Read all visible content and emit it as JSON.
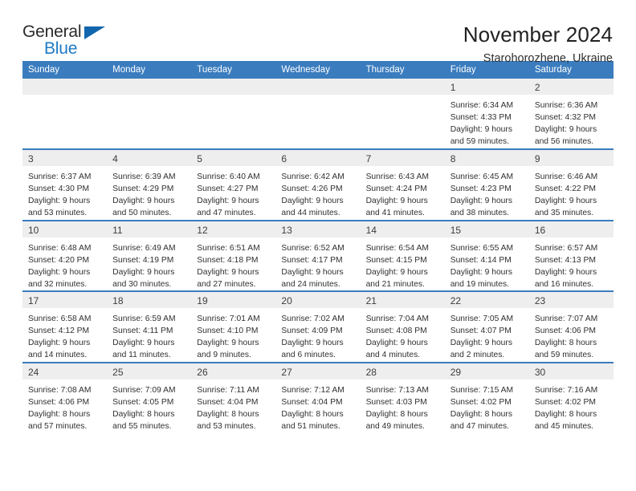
{
  "brand": {
    "name_part1": "General",
    "name_part2": "Blue",
    "mark": "triangle-logo"
  },
  "header": {
    "title": "November 2024",
    "location": "Starohorozhene, Ukraine"
  },
  "calendar": {
    "weekday_headers": [
      "Sunday",
      "Monday",
      "Tuesday",
      "Wednesday",
      "Thursday",
      "Friday",
      "Saturday"
    ],
    "accent_color": "#3a7cbe",
    "daynum_band_color": "#eeeeee",
    "weeks": [
      [
        {
          "day": "",
          "sunrise": "",
          "sunset": "",
          "daylight_line1": "",
          "daylight_line2": ""
        },
        {
          "day": "",
          "sunrise": "",
          "sunset": "",
          "daylight_line1": "",
          "daylight_line2": ""
        },
        {
          "day": "",
          "sunrise": "",
          "sunset": "",
          "daylight_line1": "",
          "daylight_line2": ""
        },
        {
          "day": "",
          "sunrise": "",
          "sunset": "",
          "daylight_line1": "",
          "daylight_line2": ""
        },
        {
          "day": "",
          "sunrise": "",
          "sunset": "",
          "daylight_line1": "",
          "daylight_line2": ""
        },
        {
          "day": "1",
          "sunrise": "Sunrise: 6:34 AM",
          "sunset": "Sunset: 4:33 PM",
          "daylight_line1": "Daylight: 9 hours",
          "daylight_line2": "and 59 minutes."
        },
        {
          "day": "2",
          "sunrise": "Sunrise: 6:36 AM",
          "sunset": "Sunset: 4:32 PM",
          "daylight_line1": "Daylight: 9 hours",
          "daylight_line2": "and 56 minutes."
        }
      ],
      [
        {
          "day": "3",
          "sunrise": "Sunrise: 6:37 AM",
          "sunset": "Sunset: 4:30 PM",
          "daylight_line1": "Daylight: 9 hours",
          "daylight_line2": "and 53 minutes."
        },
        {
          "day": "4",
          "sunrise": "Sunrise: 6:39 AM",
          "sunset": "Sunset: 4:29 PM",
          "daylight_line1": "Daylight: 9 hours",
          "daylight_line2": "and 50 minutes."
        },
        {
          "day": "5",
          "sunrise": "Sunrise: 6:40 AM",
          "sunset": "Sunset: 4:27 PM",
          "daylight_line1": "Daylight: 9 hours",
          "daylight_line2": "and 47 minutes."
        },
        {
          "day": "6",
          "sunrise": "Sunrise: 6:42 AM",
          "sunset": "Sunset: 4:26 PM",
          "daylight_line1": "Daylight: 9 hours",
          "daylight_line2": "and 44 minutes."
        },
        {
          "day": "7",
          "sunrise": "Sunrise: 6:43 AM",
          "sunset": "Sunset: 4:24 PM",
          "daylight_line1": "Daylight: 9 hours",
          "daylight_line2": "and 41 minutes."
        },
        {
          "day": "8",
          "sunrise": "Sunrise: 6:45 AM",
          "sunset": "Sunset: 4:23 PM",
          "daylight_line1": "Daylight: 9 hours",
          "daylight_line2": "and 38 minutes."
        },
        {
          "day": "9",
          "sunrise": "Sunrise: 6:46 AM",
          "sunset": "Sunset: 4:22 PM",
          "daylight_line1": "Daylight: 9 hours",
          "daylight_line2": "and 35 minutes."
        }
      ],
      [
        {
          "day": "10",
          "sunrise": "Sunrise: 6:48 AM",
          "sunset": "Sunset: 4:20 PM",
          "daylight_line1": "Daylight: 9 hours",
          "daylight_line2": "and 32 minutes."
        },
        {
          "day": "11",
          "sunrise": "Sunrise: 6:49 AM",
          "sunset": "Sunset: 4:19 PM",
          "daylight_line1": "Daylight: 9 hours",
          "daylight_line2": "and 30 minutes."
        },
        {
          "day": "12",
          "sunrise": "Sunrise: 6:51 AM",
          "sunset": "Sunset: 4:18 PM",
          "daylight_line1": "Daylight: 9 hours",
          "daylight_line2": "and 27 minutes."
        },
        {
          "day": "13",
          "sunrise": "Sunrise: 6:52 AM",
          "sunset": "Sunset: 4:17 PM",
          "daylight_line1": "Daylight: 9 hours",
          "daylight_line2": "and 24 minutes."
        },
        {
          "day": "14",
          "sunrise": "Sunrise: 6:54 AM",
          "sunset": "Sunset: 4:15 PM",
          "daylight_line1": "Daylight: 9 hours",
          "daylight_line2": "and 21 minutes."
        },
        {
          "day": "15",
          "sunrise": "Sunrise: 6:55 AM",
          "sunset": "Sunset: 4:14 PM",
          "daylight_line1": "Daylight: 9 hours",
          "daylight_line2": "and 19 minutes."
        },
        {
          "day": "16",
          "sunrise": "Sunrise: 6:57 AM",
          "sunset": "Sunset: 4:13 PM",
          "daylight_line1": "Daylight: 9 hours",
          "daylight_line2": "and 16 minutes."
        }
      ],
      [
        {
          "day": "17",
          "sunrise": "Sunrise: 6:58 AM",
          "sunset": "Sunset: 4:12 PM",
          "daylight_line1": "Daylight: 9 hours",
          "daylight_line2": "and 14 minutes."
        },
        {
          "day": "18",
          "sunrise": "Sunrise: 6:59 AM",
          "sunset": "Sunset: 4:11 PM",
          "daylight_line1": "Daylight: 9 hours",
          "daylight_line2": "and 11 minutes."
        },
        {
          "day": "19",
          "sunrise": "Sunrise: 7:01 AM",
          "sunset": "Sunset: 4:10 PM",
          "daylight_line1": "Daylight: 9 hours",
          "daylight_line2": "and 9 minutes."
        },
        {
          "day": "20",
          "sunrise": "Sunrise: 7:02 AM",
          "sunset": "Sunset: 4:09 PM",
          "daylight_line1": "Daylight: 9 hours",
          "daylight_line2": "and 6 minutes."
        },
        {
          "day": "21",
          "sunrise": "Sunrise: 7:04 AM",
          "sunset": "Sunset: 4:08 PM",
          "daylight_line1": "Daylight: 9 hours",
          "daylight_line2": "and 4 minutes."
        },
        {
          "day": "22",
          "sunrise": "Sunrise: 7:05 AM",
          "sunset": "Sunset: 4:07 PM",
          "daylight_line1": "Daylight: 9 hours",
          "daylight_line2": "and 2 minutes."
        },
        {
          "day": "23",
          "sunrise": "Sunrise: 7:07 AM",
          "sunset": "Sunset: 4:06 PM",
          "daylight_line1": "Daylight: 8 hours",
          "daylight_line2": "and 59 minutes."
        }
      ],
      [
        {
          "day": "24",
          "sunrise": "Sunrise: 7:08 AM",
          "sunset": "Sunset: 4:06 PM",
          "daylight_line1": "Daylight: 8 hours",
          "daylight_line2": "and 57 minutes."
        },
        {
          "day": "25",
          "sunrise": "Sunrise: 7:09 AM",
          "sunset": "Sunset: 4:05 PM",
          "daylight_line1": "Daylight: 8 hours",
          "daylight_line2": "and 55 minutes."
        },
        {
          "day": "26",
          "sunrise": "Sunrise: 7:11 AM",
          "sunset": "Sunset: 4:04 PM",
          "daylight_line1": "Daylight: 8 hours",
          "daylight_line2": "and 53 minutes."
        },
        {
          "day": "27",
          "sunrise": "Sunrise: 7:12 AM",
          "sunset": "Sunset: 4:04 PM",
          "daylight_line1": "Daylight: 8 hours",
          "daylight_line2": "and 51 minutes."
        },
        {
          "day": "28",
          "sunrise": "Sunrise: 7:13 AM",
          "sunset": "Sunset: 4:03 PM",
          "daylight_line1": "Daylight: 8 hours",
          "daylight_line2": "and 49 minutes."
        },
        {
          "day": "29",
          "sunrise": "Sunrise: 7:15 AM",
          "sunset": "Sunset: 4:02 PM",
          "daylight_line1": "Daylight: 8 hours",
          "daylight_line2": "and 47 minutes."
        },
        {
          "day": "30",
          "sunrise": "Sunrise: 7:16 AM",
          "sunset": "Sunset: 4:02 PM",
          "daylight_line1": "Daylight: 8 hours",
          "daylight_line2": "and 45 minutes."
        }
      ]
    ]
  }
}
